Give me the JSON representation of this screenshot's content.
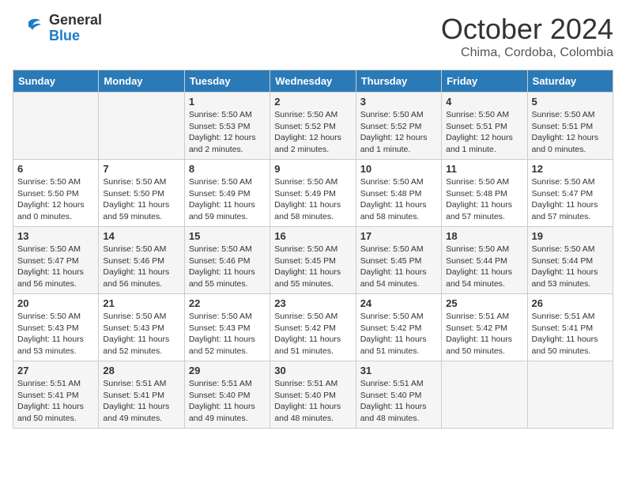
{
  "header": {
    "logo": {
      "general": "General",
      "blue": "Blue"
    },
    "title": "October 2024",
    "location": "Chima, Cordoba, Colombia"
  },
  "days_of_week": [
    "Sunday",
    "Monday",
    "Tuesday",
    "Wednesday",
    "Thursday",
    "Friday",
    "Saturday"
  ],
  "weeks": [
    [
      {
        "day": "",
        "info": ""
      },
      {
        "day": "",
        "info": ""
      },
      {
        "day": "1",
        "info": "Sunrise: 5:50 AM\nSunset: 5:53 PM\nDaylight: 12 hours\nand 2 minutes."
      },
      {
        "day": "2",
        "info": "Sunrise: 5:50 AM\nSunset: 5:52 PM\nDaylight: 12 hours\nand 2 minutes."
      },
      {
        "day": "3",
        "info": "Sunrise: 5:50 AM\nSunset: 5:52 PM\nDaylight: 12 hours\nand 1 minute."
      },
      {
        "day": "4",
        "info": "Sunrise: 5:50 AM\nSunset: 5:51 PM\nDaylight: 12 hours\nand 1 minute."
      },
      {
        "day": "5",
        "info": "Sunrise: 5:50 AM\nSunset: 5:51 PM\nDaylight: 12 hours\nand 0 minutes."
      }
    ],
    [
      {
        "day": "6",
        "info": "Sunrise: 5:50 AM\nSunset: 5:50 PM\nDaylight: 12 hours\nand 0 minutes."
      },
      {
        "day": "7",
        "info": "Sunrise: 5:50 AM\nSunset: 5:50 PM\nDaylight: 11 hours\nand 59 minutes."
      },
      {
        "day": "8",
        "info": "Sunrise: 5:50 AM\nSunset: 5:49 PM\nDaylight: 11 hours\nand 59 minutes."
      },
      {
        "day": "9",
        "info": "Sunrise: 5:50 AM\nSunset: 5:49 PM\nDaylight: 11 hours\nand 58 minutes."
      },
      {
        "day": "10",
        "info": "Sunrise: 5:50 AM\nSunset: 5:48 PM\nDaylight: 11 hours\nand 58 minutes."
      },
      {
        "day": "11",
        "info": "Sunrise: 5:50 AM\nSunset: 5:48 PM\nDaylight: 11 hours\nand 57 minutes."
      },
      {
        "day": "12",
        "info": "Sunrise: 5:50 AM\nSunset: 5:47 PM\nDaylight: 11 hours\nand 57 minutes."
      }
    ],
    [
      {
        "day": "13",
        "info": "Sunrise: 5:50 AM\nSunset: 5:47 PM\nDaylight: 11 hours\nand 56 minutes."
      },
      {
        "day": "14",
        "info": "Sunrise: 5:50 AM\nSunset: 5:46 PM\nDaylight: 11 hours\nand 56 minutes."
      },
      {
        "day": "15",
        "info": "Sunrise: 5:50 AM\nSunset: 5:46 PM\nDaylight: 11 hours\nand 55 minutes."
      },
      {
        "day": "16",
        "info": "Sunrise: 5:50 AM\nSunset: 5:45 PM\nDaylight: 11 hours\nand 55 minutes."
      },
      {
        "day": "17",
        "info": "Sunrise: 5:50 AM\nSunset: 5:45 PM\nDaylight: 11 hours\nand 54 minutes."
      },
      {
        "day": "18",
        "info": "Sunrise: 5:50 AM\nSunset: 5:44 PM\nDaylight: 11 hours\nand 54 minutes."
      },
      {
        "day": "19",
        "info": "Sunrise: 5:50 AM\nSunset: 5:44 PM\nDaylight: 11 hours\nand 53 minutes."
      }
    ],
    [
      {
        "day": "20",
        "info": "Sunrise: 5:50 AM\nSunset: 5:43 PM\nDaylight: 11 hours\nand 53 minutes."
      },
      {
        "day": "21",
        "info": "Sunrise: 5:50 AM\nSunset: 5:43 PM\nDaylight: 11 hours\nand 52 minutes."
      },
      {
        "day": "22",
        "info": "Sunrise: 5:50 AM\nSunset: 5:43 PM\nDaylight: 11 hours\nand 52 minutes."
      },
      {
        "day": "23",
        "info": "Sunrise: 5:50 AM\nSunset: 5:42 PM\nDaylight: 11 hours\nand 51 minutes."
      },
      {
        "day": "24",
        "info": "Sunrise: 5:50 AM\nSunset: 5:42 PM\nDaylight: 11 hours\nand 51 minutes."
      },
      {
        "day": "25",
        "info": "Sunrise: 5:51 AM\nSunset: 5:42 PM\nDaylight: 11 hours\nand 50 minutes."
      },
      {
        "day": "26",
        "info": "Sunrise: 5:51 AM\nSunset: 5:41 PM\nDaylight: 11 hours\nand 50 minutes."
      }
    ],
    [
      {
        "day": "27",
        "info": "Sunrise: 5:51 AM\nSunset: 5:41 PM\nDaylight: 11 hours\nand 50 minutes."
      },
      {
        "day": "28",
        "info": "Sunrise: 5:51 AM\nSunset: 5:41 PM\nDaylight: 11 hours\nand 49 minutes."
      },
      {
        "day": "29",
        "info": "Sunrise: 5:51 AM\nSunset: 5:40 PM\nDaylight: 11 hours\nand 49 minutes."
      },
      {
        "day": "30",
        "info": "Sunrise: 5:51 AM\nSunset: 5:40 PM\nDaylight: 11 hours\nand 48 minutes."
      },
      {
        "day": "31",
        "info": "Sunrise: 5:51 AM\nSunset: 5:40 PM\nDaylight: 11 hours\nand 48 minutes."
      },
      {
        "day": "",
        "info": ""
      },
      {
        "day": "",
        "info": ""
      }
    ]
  ]
}
